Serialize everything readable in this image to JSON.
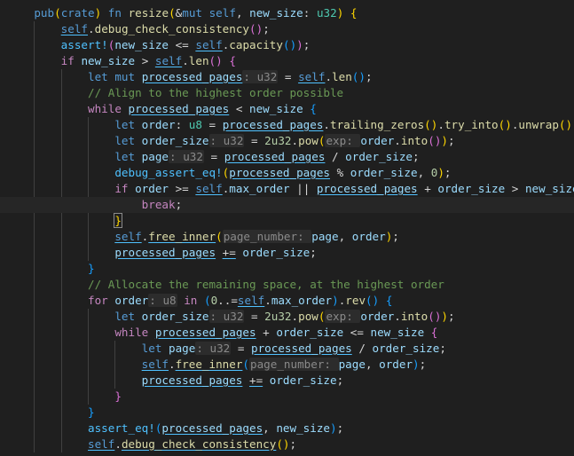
{
  "colors": {
    "background": "#1f1f1f",
    "keyword": "#569cd6",
    "control": "#c586c0",
    "function": "#dcdcaa",
    "macro": "#4fc1ff",
    "variable": "#9cdcfe",
    "self": "#569cd6",
    "type": "#4ec9b0",
    "number": "#b5cea8",
    "comment": "#6a9955",
    "plain": "#d4d4d4",
    "bracket1": "#ffd700",
    "bracket2": "#da70d6",
    "bracket3": "#179fff"
  },
  "lines": [
    {
      "indent": 1,
      "tokens": [
        [
          "pub",
          "k"
        ],
        [
          "(",
          "b1"
        ],
        [
          "crate",
          "k"
        ],
        [
          ")",
          "b1"
        ],
        [
          " ",
          "p"
        ],
        [
          "fn",
          "k"
        ],
        [
          " ",
          "p"
        ],
        [
          "resize",
          "f"
        ],
        [
          "(",
          "b1"
        ],
        [
          "&",
          "p"
        ],
        [
          "mut",
          "k"
        ],
        [
          " ",
          "p"
        ],
        [
          "self",
          "s"
        ],
        [
          ", ",
          "p"
        ],
        [
          "new_size",
          "v"
        ],
        [
          ": ",
          "p"
        ],
        [
          "u32",
          "t"
        ],
        [
          ")",
          "b1"
        ],
        [
          " ",
          "p"
        ],
        [
          "{",
          "b1"
        ]
      ]
    },
    {
      "indent": 2,
      "tokens": [
        [
          "self",
          "su"
        ],
        [
          ".",
          "p"
        ],
        [
          "debug_check_consistency",
          "f"
        ],
        [
          "(",
          "b2"
        ],
        [
          ")",
          "b2"
        ],
        [
          ";",
          "p"
        ]
      ]
    },
    {
      "indent": 2,
      "tokens": [
        [
          "assert!",
          "m"
        ],
        [
          "(",
          "b2"
        ],
        [
          "new_size",
          "v"
        ],
        [
          " <= ",
          "p"
        ],
        [
          "self",
          "su"
        ],
        [
          ".",
          "p"
        ],
        [
          "capacity",
          "f"
        ],
        [
          "(",
          "b3"
        ],
        [
          ")",
          "b3"
        ],
        [
          ")",
          "b2"
        ],
        [
          ";",
          "p"
        ]
      ]
    },
    {
      "indent": 2,
      "tokens": [
        [
          "if",
          "c"
        ],
        [
          " ",
          "p"
        ],
        [
          "new_size",
          "v"
        ],
        [
          " > ",
          "p"
        ],
        [
          "self",
          "su"
        ],
        [
          ".",
          "p"
        ],
        [
          "len",
          "f"
        ],
        [
          "(",
          "b2"
        ],
        [
          ")",
          "b2"
        ],
        [
          " ",
          "p"
        ],
        [
          "{",
          "b2"
        ]
      ]
    },
    {
      "indent": 3,
      "tokens": [
        [
          "let",
          "k"
        ],
        [
          " ",
          "p"
        ],
        [
          "mut",
          "k"
        ],
        [
          " ",
          "p"
        ],
        [
          "processed_pages",
          "vu"
        ],
        [
          "u32",
          "h"
        ],
        [
          " = ",
          "p"
        ],
        [
          "self",
          "su"
        ],
        [
          ".",
          "p"
        ],
        [
          "len",
          "f"
        ],
        [
          "(",
          "b3"
        ],
        [
          ")",
          "b3"
        ],
        [
          ";",
          "p"
        ]
      ]
    },
    {
      "indent": 3,
      "tokens": [
        [
          "// Align to the highest order possible",
          "cm"
        ]
      ]
    },
    {
      "indent": 3,
      "tokens": [
        [
          "while",
          "c"
        ],
        [
          " ",
          "p"
        ],
        [
          "processed_pages",
          "vu"
        ],
        [
          " < ",
          "p"
        ],
        [
          "new_size",
          "v"
        ],
        [
          " ",
          "p"
        ],
        [
          "{",
          "b3"
        ]
      ]
    },
    {
      "indent": 4,
      "tokens": [
        [
          "let",
          "k"
        ],
        [
          " ",
          "p"
        ],
        [
          "order",
          "v"
        ],
        [
          ": ",
          "p"
        ],
        [
          "u8",
          "t"
        ],
        [
          " = ",
          "p"
        ],
        [
          "processed_pages",
          "vu"
        ],
        [
          ".",
          "p"
        ],
        [
          "trailing_zeros",
          "f"
        ],
        [
          "(",
          "b1"
        ],
        [
          ")",
          "b1"
        ],
        [
          ".",
          "p"
        ],
        [
          "try_into",
          "f"
        ],
        [
          "(",
          "b1"
        ],
        [
          ")",
          "b1"
        ],
        [
          ".",
          "p"
        ],
        [
          "unwrap",
          "f"
        ],
        [
          "(",
          "b1"
        ],
        [
          ")",
          "b1"
        ],
        [
          ";",
          "p"
        ]
      ]
    },
    {
      "indent": 4,
      "tokens": [
        [
          "let",
          "k"
        ],
        [
          " ",
          "p"
        ],
        [
          "order_size",
          "v"
        ],
        [
          "u32",
          "h"
        ],
        [
          " = ",
          "p"
        ],
        [
          "2u32",
          "n"
        ],
        [
          ".",
          "p"
        ],
        [
          "pow",
          "f"
        ],
        [
          "(",
          "b1"
        ],
        [
          "exp",
          "h"
        ],
        [
          "order",
          "v"
        ],
        [
          ".",
          "p"
        ],
        [
          "into",
          "f"
        ],
        [
          "(",
          "b2"
        ],
        [
          ")",
          "b2"
        ],
        [
          ")",
          "b1"
        ],
        [
          ";",
          "p"
        ]
      ]
    },
    {
      "indent": 4,
      "tokens": [
        [
          "let",
          "k"
        ],
        [
          " ",
          "p"
        ],
        [
          "page",
          "v"
        ],
        [
          "u32",
          "h"
        ],
        [
          " = ",
          "p"
        ],
        [
          "processed_pages",
          "vu"
        ],
        [
          " / ",
          "p"
        ],
        [
          "order_size",
          "v"
        ],
        [
          ";",
          "p"
        ]
      ]
    },
    {
      "indent": 4,
      "tokens": [
        [
          "debug_assert_eq!",
          "m"
        ],
        [
          "(",
          "b1"
        ],
        [
          "processed_pages",
          "vu"
        ],
        [
          " % ",
          "p"
        ],
        [
          "order_size",
          "v"
        ],
        [
          ", ",
          "p"
        ],
        [
          "0",
          "n"
        ],
        [
          ")",
          "b1"
        ],
        [
          ";",
          "p"
        ]
      ]
    },
    {
      "indent": 4,
      "tokens": [
        [
          "if",
          "c"
        ],
        [
          " ",
          "p"
        ],
        [
          "order",
          "v"
        ],
        [
          " >= ",
          "p"
        ],
        [
          "self",
          "su"
        ],
        [
          ".",
          "p"
        ],
        [
          "max_order",
          "v"
        ],
        [
          " || ",
          "p"
        ],
        [
          "processed_pages",
          "vu"
        ],
        [
          " + ",
          "p"
        ],
        [
          "order_size",
          "v"
        ],
        [
          " > ",
          "p"
        ],
        [
          "new_size",
          "v"
        ],
        [
          " ",
          "p"
        ],
        [
          "{",
          "b1m"
        ]
      ]
    },
    {
      "indent": 5,
      "current": true,
      "tokens": [
        [
          "break",
          "c"
        ],
        [
          ";",
          "p"
        ]
      ]
    },
    {
      "indent": 4,
      "tokens": [
        [
          "}",
          "b1m"
        ]
      ]
    },
    {
      "indent": 4,
      "tokens": [
        [
          "self",
          "su"
        ],
        [
          ".",
          "p"
        ],
        [
          "free_inner",
          "fu"
        ],
        [
          "(",
          "b1"
        ],
        [
          "page_number",
          "h"
        ],
        [
          "page",
          "v"
        ],
        [
          ", ",
          "p"
        ],
        [
          "order",
          "v"
        ],
        [
          ")",
          "b1"
        ],
        [
          ";",
          "p"
        ]
      ]
    },
    {
      "indent": 4,
      "tokens": [
        [
          "processed_pages",
          "vu"
        ],
        [
          " ",
          "p"
        ],
        [
          "+=",
          "pu"
        ],
        [
          " ",
          "p"
        ],
        [
          "order_size",
          "v"
        ],
        [
          ";",
          "p"
        ]
      ]
    },
    {
      "indent": 3,
      "tokens": [
        [
          "}",
          "b3"
        ]
      ]
    },
    {
      "indent": 3,
      "tokens": [
        [
          "// Allocate the remaining space, at the highest order",
          "cm"
        ]
      ]
    },
    {
      "indent": 3,
      "tokens": [
        [
          "for",
          "c"
        ],
        [
          " ",
          "p"
        ],
        [
          "order",
          "v"
        ],
        [
          "u8",
          "h"
        ],
        [
          " ",
          "p"
        ],
        [
          "in",
          "c"
        ],
        [
          " ",
          "p"
        ],
        [
          "(",
          "b3"
        ],
        [
          "0",
          "n"
        ],
        [
          "..=",
          "p"
        ],
        [
          "self",
          "su"
        ],
        [
          ".",
          "p"
        ],
        [
          "max_order",
          "v"
        ],
        [
          ")",
          "b3"
        ],
        [
          ".",
          "p"
        ],
        [
          "rev",
          "f"
        ],
        [
          "(",
          "b3"
        ],
        [
          ")",
          "b3"
        ],
        [
          " ",
          "p"
        ],
        [
          "{",
          "b3"
        ]
      ]
    },
    {
      "indent": 4,
      "tokens": [
        [
          "let",
          "k"
        ],
        [
          " ",
          "p"
        ],
        [
          "order_size",
          "v"
        ],
        [
          "u32",
          "h"
        ],
        [
          " = ",
          "p"
        ],
        [
          "2u32",
          "n"
        ],
        [
          ".",
          "p"
        ],
        [
          "pow",
          "f"
        ],
        [
          "(",
          "b1"
        ],
        [
          "exp",
          "h"
        ],
        [
          "order",
          "v"
        ],
        [
          ".",
          "p"
        ],
        [
          "into",
          "f"
        ],
        [
          "(",
          "b2"
        ],
        [
          ")",
          "b2"
        ],
        [
          ")",
          "b1"
        ],
        [
          ";",
          "p"
        ]
      ]
    },
    {
      "indent": 4,
      "tokens": [
        [
          "while",
          "c"
        ],
        [
          " ",
          "p"
        ],
        [
          "processed_pages",
          "vu"
        ],
        [
          " + ",
          "p"
        ],
        [
          "order_size",
          "v"
        ],
        [
          " <= ",
          "p"
        ],
        [
          "new_size",
          "v"
        ],
        [
          " ",
          "p"
        ],
        [
          "{",
          "b2"
        ]
      ]
    },
    {
      "indent": 5,
      "tokens": [
        [
          "let",
          "k"
        ],
        [
          " ",
          "p"
        ],
        [
          "page",
          "v"
        ],
        [
          "u32",
          "h"
        ],
        [
          " = ",
          "p"
        ],
        [
          "processed_pages",
          "vu"
        ],
        [
          " / ",
          "p"
        ],
        [
          "order_size",
          "v"
        ],
        [
          ";",
          "p"
        ]
      ]
    },
    {
      "indent": 5,
      "tokens": [
        [
          "self",
          "su"
        ],
        [
          ".",
          "p"
        ],
        [
          "free_inner",
          "fu"
        ],
        [
          "(",
          "b3"
        ],
        [
          "page_number",
          "h"
        ],
        [
          "page",
          "v"
        ],
        [
          ", ",
          "p"
        ],
        [
          "order",
          "v"
        ],
        [
          ")",
          "b3"
        ],
        [
          ";",
          "p"
        ]
      ]
    },
    {
      "indent": 5,
      "tokens": [
        [
          "processed_pages",
          "vu"
        ],
        [
          " ",
          "p"
        ],
        [
          "+=",
          "pu"
        ],
        [
          " ",
          "p"
        ],
        [
          "order_size",
          "v"
        ],
        [
          ";",
          "p"
        ]
      ]
    },
    {
      "indent": 4,
      "tokens": [
        [
          "}",
          "b2"
        ]
      ]
    },
    {
      "indent": 3,
      "tokens": [
        [
          "}",
          "b3"
        ]
      ]
    },
    {
      "indent": 3,
      "tokens": [
        [
          "assert_eq!",
          "m"
        ],
        [
          "(",
          "b3"
        ],
        [
          "processed_pages",
          "vu"
        ],
        [
          ", ",
          "p"
        ],
        [
          "new_size",
          "v"
        ],
        [
          ")",
          "b3"
        ],
        [
          ";",
          "p"
        ]
      ]
    },
    {
      "indent": 3,
      "tokens": [
        [
          "self",
          "su"
        ],
        [
          ".",
          "p"
        ],
        [
          "debug_check_consistency",
          "fu"
        ],
        [
          "(",
          "b1"
        ],
        [
          ")",
          "b1"
        ],
        [
          ";",
          "p"
        ]
      ]
    }
  ]
}
